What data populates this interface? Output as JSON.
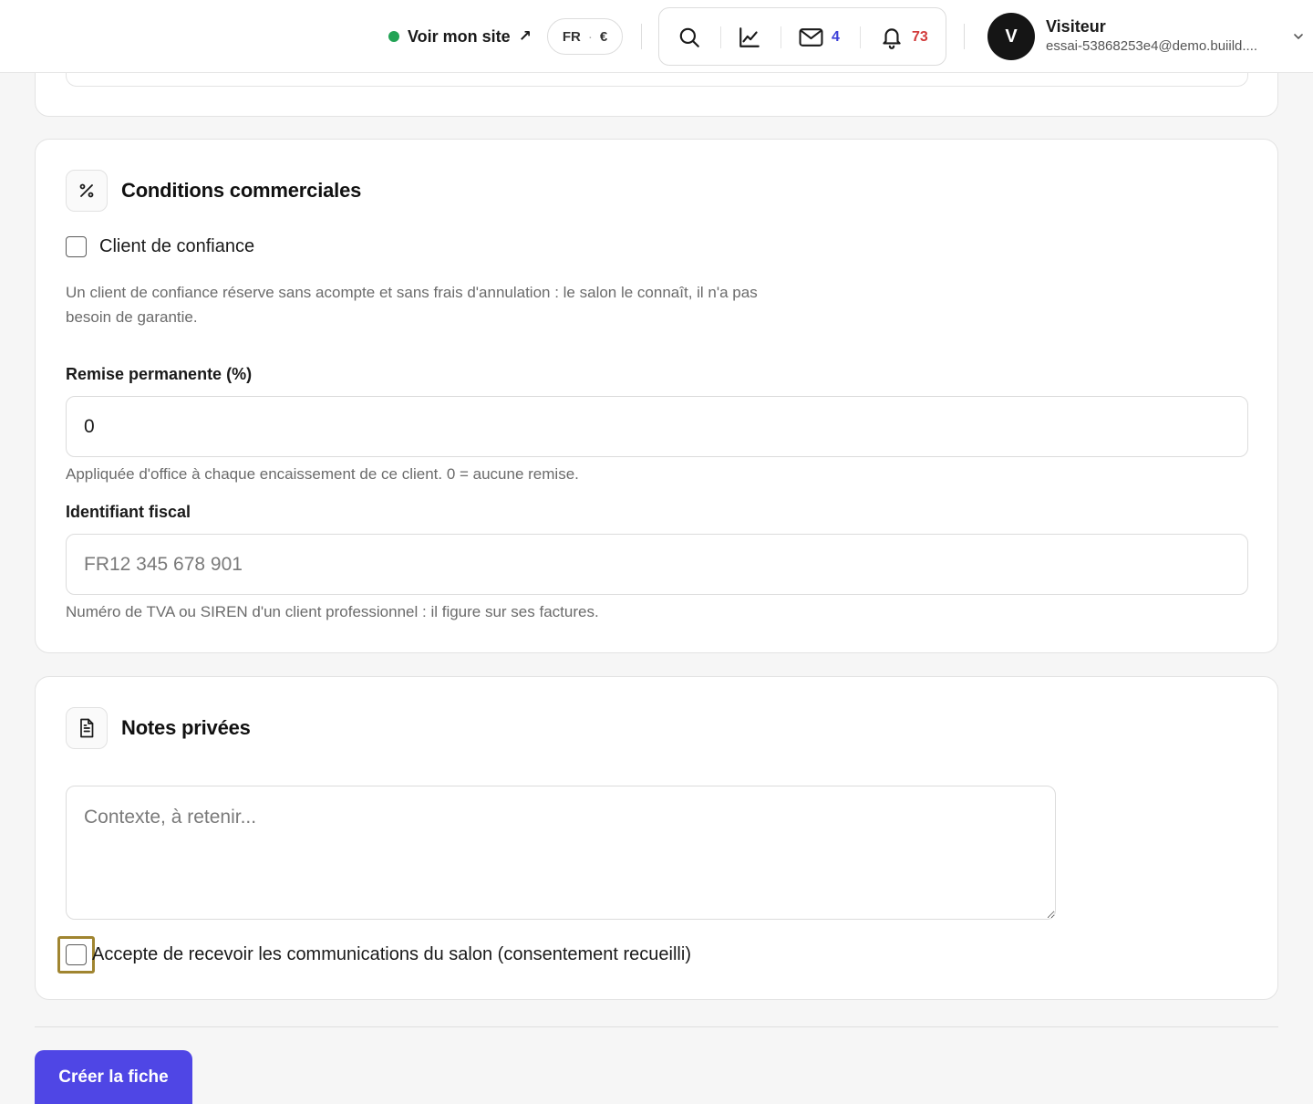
{
  "header": {
    "site_link_label": "Voir mon site",
    "site_link_arrow": "↗",
    "status_color": "#22a355",
    "lang": "FR",
    "lang_separator": "·",
    "currency": "€",
    "tools": [
      {
        "icon": "search-icon"
      },
      {
        "icon": "chart-line-icon"
      },
      {
        "icon": "mail-icon",
        "count": "4",
        "count_color": "#3b3fd8"
      },
      {
        "icon": "bell-icon",
        "count": "73",
        "count_color": "#d23a3a"
      }
    ],
    "user": {
      "avatar_initial": "V",
      "name": "Visiteur",
      "email": "essai-53868253e4@demo.buiild...."
    }
  },
  "conditions": {
    "title": "Conditions commerciales",
    "icon": "percent-icon",
    "trusted_client_label": "Client de confiance",
    "trusted_client_checked": false,
    "trusted_client_help": "Un client de confiance réserve sans acompte et sans frais d'annulation : le salon le connaît, il n'a pas",
    "trusted_client_help_line2": "besoin de garantie.",
    "discount_label": "Remise permanente (%)",
    "discount_value": "0",
    "discount_help": "Appliquée d'office à chaque encaissement de ce client. 0 = aucune remise.",
    "tax_id_label": "Identifiant fiscal",
    "tax_id_value": "",
    "tax_id_placeholder": "FR12 345 678 901",
    "tax_id_help": "Numéro de TVA ou SIREN d'un client professionnel : il figure sur ses factures."
  },
  "notes": {
    "title": "Notes privées",
    "icon": "document-icon",
    "textarea_value": "",
    "textarea_placeholder": "Contexte, à retenir...",
    "consent_label": "Accepte de recevoir les communications du salon (consentement recueilli)",
    "consent_checked": false
  },
  "actions": {
    "submit_label": "Créer la fiche",
    "submit_color": "#4f46e5"
  }
}
